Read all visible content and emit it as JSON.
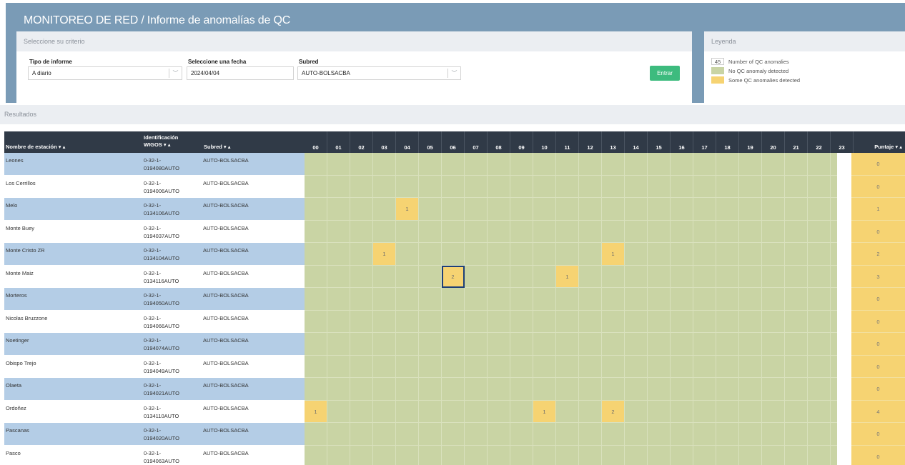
{
  "header": {
    "title": "MONITOREO DE RED / Informe de anomalías de QC"
  },
  "criteria": {
    "heading": "Seleccione su criterio",
    "report_type_label": "Tipo de informe",
    "report_type_value": "A diario",
    "date_label": "Seleccione una fecha",
    "date_value": "2024/04/04",
    "subnet_label": "Subred",
    "subnet_value": "AUTO-BOLSACBA",
    "enter_label": "Entrar"
  },
  "legend": {
    "heading": "Leyenda",
    "items": [
      {
        "swatch": "45",
        "label": "Number of QC anomalies",
        "color": "#ffffff"
      },
      {
        "swatch": "",
        "label": "No QC anomaly detected",
        "color": "#c9d4a4"
      },
      {
        "swatch": "",
        "label": "Some QC anomalies detected",
        "color": "#f6d372"
      }
    ]
  },
  "results": {
    "heading": "Resultados",
    "columns": {
      "station": "Nombre de estación ▾ ▴",
      "wigos_1": "Identificación",
      "wigos_2": "WIGOS ▾ ▴",
      "subnet": "Subred ▾ ▴",
      "score": "Puntaje ▾ ▴"
    },
    "hours": [
      "00",
      "01",
      "02",
      "03",
      "04",
      "05",
      "06",
      "07",
      "08",
      "09",
      "10",
      "11",
      "12",
      "13",
      "14",
      "15",
      "16",
      "17",
      "18",
      "19",
      "20",
      "21",
      "22",
      "23"
    ],
    "rows": [
      {
        "station": "Leones",
        "wigos_1": "0-32-1-",
        "wigos_2": "0194080AUTO",
        "subnet": "AUTO-BOLSACBA",
        "anomalies": {},
        "score": "0"
      },
      {
        "station": "Los Cerrillos",
        "wigos_1": "0-32-1-",
        "wigos_2": "0194006AUTO",
        "subnet": "AUTO-BOLSACBA",
        "anomalies": {},
        "score": "0"
      },
      {
        "station": "Melo",
        "wigos_1": "0-32-1-",
        "wigos_2": "0134106AUTO",
        "subnet": "AUTO-BOLSACBA",
        "anomalies": {
          "04": "1"
        },
        "score": "1"
      },
      {
        "station": "Monte Buey",
        "wigos_1": "0-32-1-",
        "wigos_2": "0194037AUTO",
        "subnet": "AUTO-BOLSACBA",
        "anomalies": {},
        "score": "0"
      },
      {
        "station": "Monte Cristo ZR",
        "wigos_1": "0-32-1-",
        "wigos_2": "0134104AUTO",
        "subnet": "AUTO-BOLSACBA",
        "anomalies": {
          "03": "1",
          "13": "1"
        },
        "score": "2"
      },
      {
        "station": "Monte Maiz",
        "wigos_1": "0-32-1-",
        "wigos_2": "0134116AUTO",
        "subnet": "AUTO-BOLSACBA",
        "anomalies": {
          "06": "2",
          "11": "1"
        },
        "score": "3",
        "selected_hour": "06"
      },
      {
        "station": "Morteros",
        "wigos_1": "0-32-1-",
        "wigos_2": "0194050AUTO",
        "subnet": "AUTO-BOLSACBA",
        "anomalies": {},
        "score": "0"
      },
      {
        "station": "Nicolas Bruzzone",
        "wigos_1": "0-32-1-",
        "wigos_2": "0194066AUTO",
        "subnet": "AUTO-BOLSACBA",
        "anomalies": {},
        "score": "0"
      },
      {
        "station": "Noetinger",
        "wigos_1": "0-32-1-",
        "wigos_2": "0194074AUTO",
        "subnet": "AUTO-BOLSACBA",
        "anomalies": {},
        "score": "0"
      },
      {
        "station": "Obispo Trejo",
        "wigos_1": "0-32-1-",
        "wigos_2": "0194049AUTO",
        "subnet": "AUTO-BOLSACBA",
        "anomalies": {},
        "score": "0"
      },
      {
        "station": "Olaeta",
        "wigos_1": "0-32-1-",
        "wigos_2": "0194021AUTO",
        "subnet": "AUTO-BOLSACBA",
        "anomalies": {},
        "score": "0"
      },
      {
        "station": "Ordoñez",
        "wigos_1": "0-32-1-",
        "wigos_2": "0134110AUTO",
        "subnet": "AUTO-BOLSACBA",
        "anomalies": {
          "00": "1",
          "10": "1",
          "13": "2"
        },
        "score": "4"
      },
      {
        "station": "Pascanas",
        "wigos_1": "0-32-1-",
        "wigos_2": "0194020AUTO",
        "subnet": "AUTO-BOLSACBA",
        "anomalies": {},
        "score": "0"
      },
      {
        "station": "Pasco",
        "wigos_1": "0-32-1-",
        "wigos_2": "0194063AUTO",
        "subnet": "AUTO-BOLSACBA",
        "anomalies": {},
        "score": "0"
      }
    ]
  },
  "colors": {
    "header_band": "#7a9bb6",
    "ok": "#c9d4a4",
    "anomaly": "#f6d372",
    "table_header": "#303a47",
    "row_highlight": "#b4cde6",
    "enter_button": "#3dbb7e",
    "selection": "#1d3f78"
  },
  "icons": {
    "dropdown": "chevron-down-icon",
    "sort": "sort-arrows-icon"
  }
}
